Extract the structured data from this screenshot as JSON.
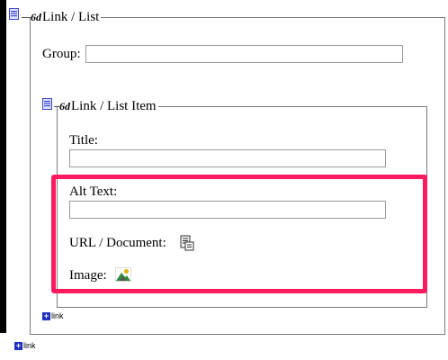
{
  "outer": {
    "legend": "Link / List",
    "legend_mark": "6d",
    "group_label": "Group:",
    "group_value": ""
  },
  "inner": {
    "legend": "Link / List Item",
    "legend_mark": "6d",
    "title_label": "Title:",
    "title_value": "",
    "alt_label": "Alt Text:",
    "alt_value": "",
    "url_label": "URL / Document:",
    "image_label": "Image:"
  },
  "add_link_inner": "link",
  "add_link_outer": "link",
  "colors": {
    "highlight": "#ff1a5f",
    "doc_icon": "#3b46c9",
    "plus": "#1f2fbf"
  }
}
